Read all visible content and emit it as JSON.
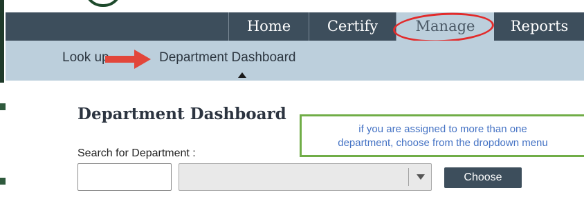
{
  "top_nav": {
    "items": [
      {
        "label": "Home"
      },
      {
        "label": "Certify"
      },
      {
        "label": "Manage"
      },
      {
        "label": "Reports"
      }
    ]
  },
  "sub_nav": {
    "items": [
      {
        "label": "Look up"
      },
      {
        "label": "Department Dashboard"
      }
    ]
  },
  "page": {
    "title": "Department Dashboard"
  },
  "callout": {
    "line1": "if you are assigned to more than one",
    "line2": "department, choose from the dropdown menu"
  },
  "search": {
    "label": "Search for Department :",
    "value": "",
    "dropdown_value": "",
    "choose_label": "Choose"
  },
  "colors": {
    "nav_bg": "#3d4e5c",
    "subnav_bg": "#bccfdc",
    "annotation_red": "#e22b2b",
    "callout_border": "#70ad47",
    "callout_text": "#4472c4"
  }
}
